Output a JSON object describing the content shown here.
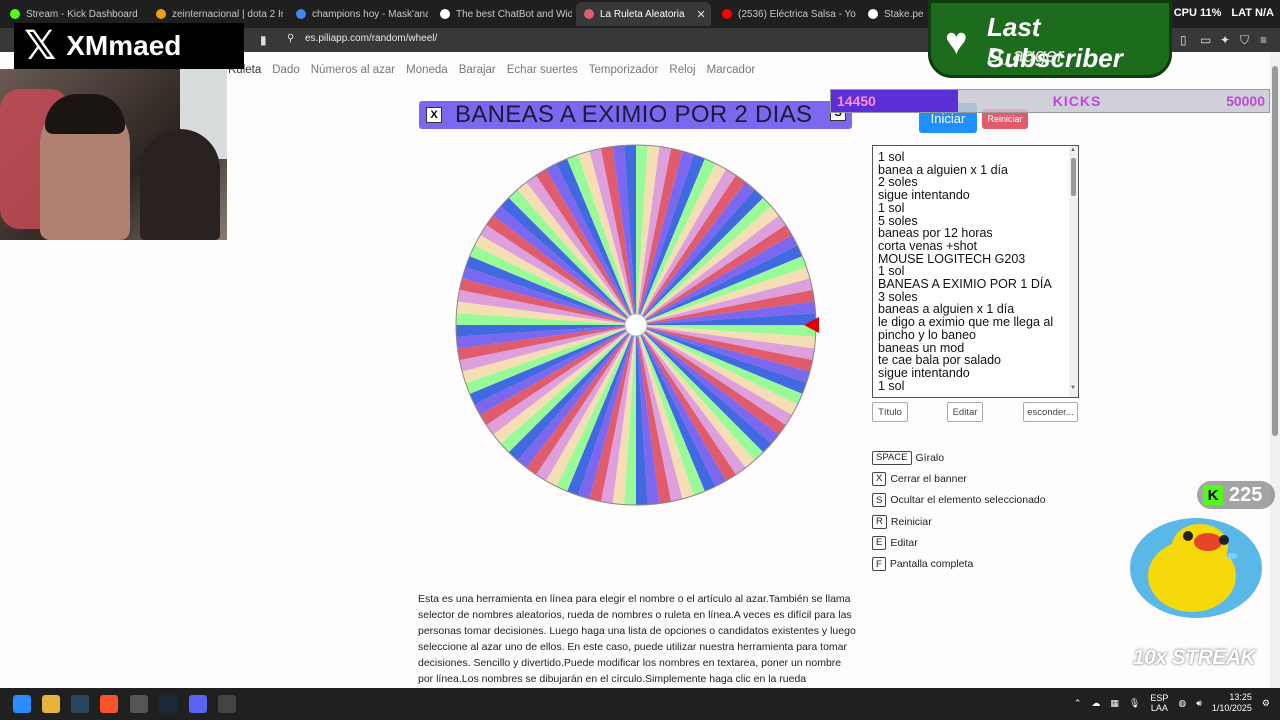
{
  "browser": {
    "tabs": [
      {
        "title": "Stream - Kick Dashboard",
        "color": "#53fc18"
      },
      {
        "title": "zeinternacional | dota 2 Inicio",
        "color": "#e7a017"
      },
      {
        "title": "champions hoy - Mask'ana Go",
        "color": "#4285f4"
      },
      {
        "title": "The best ChatBot and Widget",
        "color": "#ffffff"
      },
      {
        "title": "La Ruleta Aleatoria",
        "color": "#e05c6c",
        "active": true
      },
      {
        "title": "(2536) Eléctrica Salsa - You",
        "color": "#ff0000"
      },
      {
        "title": "Stake.pe",
        "color": "#ffffff"
      }
    ],
    "url": "es.piliapp.com/random/wheel/",
    "stats": {
      "cpu": "CPU 11%",
      "lat": "LAT N/A"
    }
  },
  "site_nav": [
    "Ruleta",
    "Dado",
    "Números al azar",
    "Moneda",
    "Barajar",
    "Echar suertes",
    "Temporizador",
    "Reloj",
    "Marcador"
  ],
  "banner": {
    "close_key": "X",
    "title": "BANEAS A EXIMIO POR 2 DIAS",
    "hide_key": "S"
  },
  "buttons": {
    "start": "Iniciar",
    "reset": "Reiniciar"
  },
  "options_list": [
    "1 sol",
    "banea a alguien x 1 día",
    "2 soles",
    "sigue intentando",
    "1 sol",
    "5 soles",
    "baneas por 12 horas",
    "corta venas +shot",
    "MOUSE LOGITECH G203",
    "1 sol",
    "BANEAS A EXIMIO POR 1 DÍA",
    "3 soles",
    "baneas a alguien x 1 día",
    "le digo a eximio que me llega al",
    "pincho y lo baneo",
    "baneas un mod",
    "te cae bala por salado",
    "sigue intentando",
    "1 sol"
  ],
  "list_buttons": {
    "title": "Título",
    "edit": "Editar",
    "hide": "esconder..."
  },
  "shortcuts": [
    {
      "key": "SPACE",
      "label": "Gíralo"
    },
    {
      "key": "X",
      "label": "Cerrar el banner"
    },
    {
      "key": "S",
      "label": "Ocultar el elemento seleccionado"
    },
    {
      "key": "R",
      "label": "Reiniciar"
    },
    {
      "key": "E",
      "label": "Editar"
    },
    {
      "key": "F",
      "label": "Pantalla completa"
    }
  ],
  "description": "Esta es una herramienta en línea para elegir el nombre o el artículo al azar.También se llama selector de nombres aleatorios, rueda de nombres o ruleta en línea.A veces es difícil para las personas tomar decisiones. Luego haga una lista de opciones o candidatos existentes y luego seleccione al azar uno de ellos. En este caso, puede utilizar nuestra herramienta para tomar decisiones. Sencillo y divertido.Puede modificar los nombres en textarea, poner un nombre por línea.Los nombres se dibujarán en el círculo.Simplemente haga clic en la rueda",
  "wheel": {
    "segments": 96,
    "colors": [
      "#98fb98",
      "#f5deb3",
      "#dda0dd",
      "#e05c6c",
      "#7b68ee",
      "#4169e1"
    ],
    "pointer_color": "#e00000"
  },
  "overlay": {
    "streamer_name": "XMmaed",
    "last_subscriber_title": "Last Subscriber",
    "last_subscriber_name": "D_agger",
    "goal_current": "14450",
    "goal_label": "KICKS",
    "goal_max": "50000",
    "goal_fraction": 0.289,
    "kick_count": "225",
    "streak_text": "10x STREAK"
  },
  "taskbar": {
    "lang": "ESP",
    "lang_sub": "LAA",
    "time": "13:25",
    "date": "1/10/2025"
  }
}
